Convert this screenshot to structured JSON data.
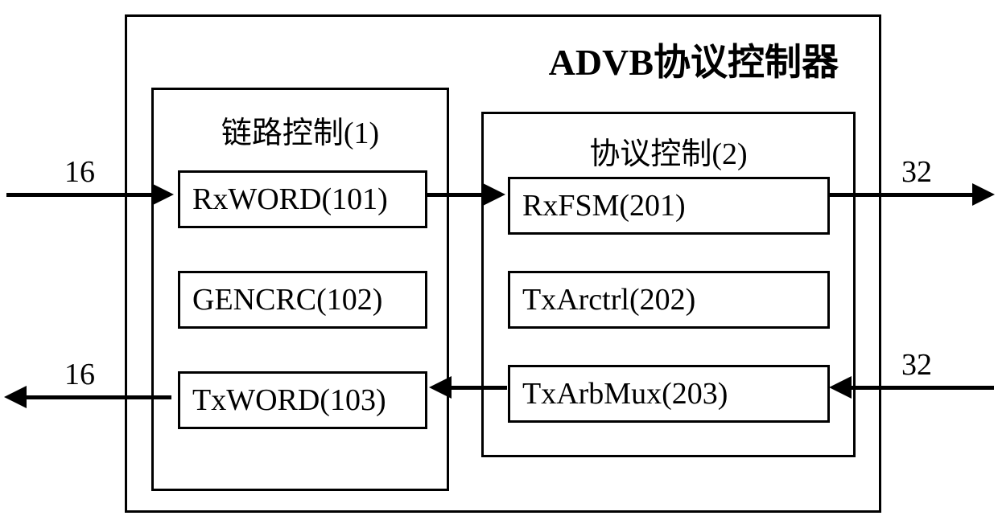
{
  "title": "ADVB协议控制器",
  "link_control": {
    "title": "链路控制(1)",
    "rxword": "RxWORD(101)",
    "gencrc": "GENCRC(102)",
    "txword": "TxWORD(103)"
  },
  "protocol_control": {
    "title": "协议控制(2)",
    "rxfsm": "RxFSM(201)",
    "txarctrl": "TxArctrl(202)",
    "txarbmux": "TxArbMux(203)"
  },
  "bus_widths": {
    "in_left_top": "16",
    "out_left_bottom": "16",
    "out_right_top": "32",
    "in_right_bottom": "32"
  }
}
